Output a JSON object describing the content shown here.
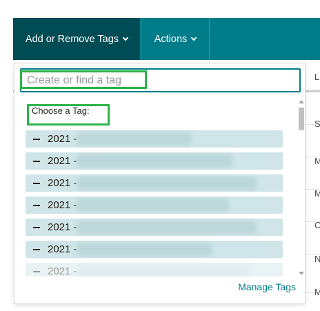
{
  "toolbar": {
    "tags_label": "Add or Remove Tags",
    "actions_label": "Actions"
  },
  "background_table": {
    "header": "La",
    "row_initials": [
      "S",
      "M",
      "M",
      "C",
      "N",
      "M"
    ]
  },
  "dropdown": {
    "search_placeholder": "Create or find a tag",
    "choose_label": "Choose a Tag:",
    "tags": [
      {
        "label": "2021 -"
      },
      {
        "label": "2021 -"
      },
      {
        "label": "2021 -"
      },
      {
        "label": "2021 -"
      },
      {
        "label": "2021 -"
      },
      {
        "label": "2021 -"
      },
      {
        "label": "2021 -"
      }
    ],
    "manage_label": "Manage Tags"
  },
  "colors": {
    "toolbar": "#007c89",
    "toolbar_active": "#004c55",
    "tag_background": "#cfe5e7",
    "highlight_box": "#2db34a",
    "link": "#007c89"
  }
}
